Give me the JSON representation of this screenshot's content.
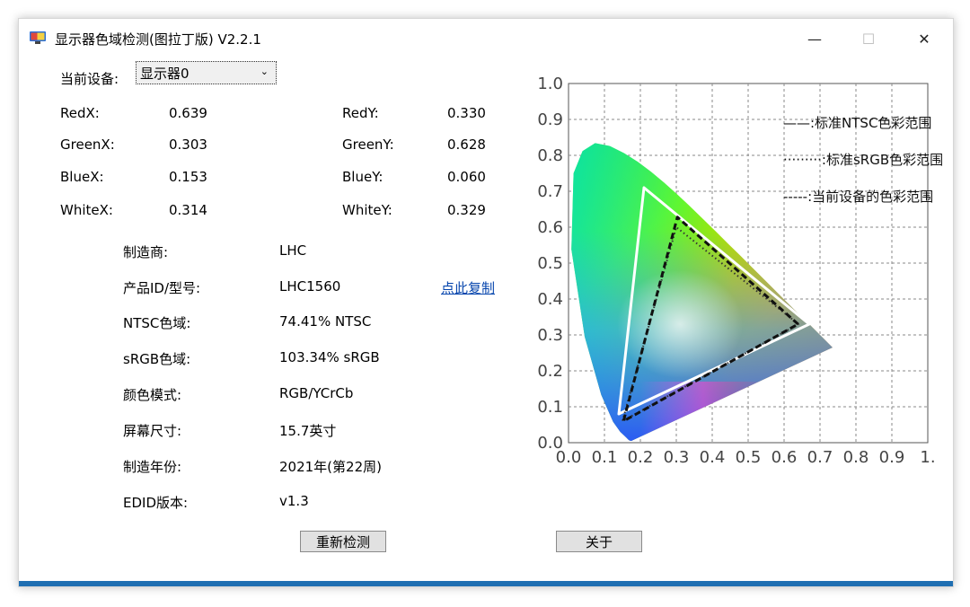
{
  "window": {
    "title": "显示器色域检测(图拉丁版) V2.2.1",
    "minimize_label": "—",
    "maximize_label": "☐",
    "close_label": "✕"
  },
  "device": {
    "label": "当前设备:",
    "selected": "显示器0"
  },
  "coords": [
    {
      "xlabel": "RedX:",
      "xval": "0.639",
      "ylabel": "RedY:",
      "yval": "0.330"
    },
    {
      "xlabel": "GreenX:",
      "xval": "0.303",
      "ylabel": "GreenY:",
      "yval": "0.628"
    },
    {
      "xlabel": "BlueX:",
      "xval": "0.153",
      "ylabel": "BlueY:",
      "yval": "0.060"
    },
    {
      "xlabel": "WhiteX:",
      "xval": "0.314",
      "ylabel": "WhiteY:",
      "yval": "0.329"
    }
  ],
  "info": [
    {
      "label": "制造商:",
      "value": "LHC"
    },
    {
      "label": "产品ID/型号:",
      "value": "LHC1560"
    },
    {
      "label": "NTSC色域:",
      "value": "74.41% NTSC"
    },
    {
      "label": "sRGB色域:",
      "value": "103.34% sRGB"
    },
    {
      "label": "颜色模式:",
      "value": "RGB/YCrCb"
    },
    {
      "label": "屏幕尺寸:",
      "value": "15.7英寸"
    },
    {
      "label": "制造年份:",
      "value": "2021年(第22周)"
    },
    {
      "label": "EDID版本:",
      "value": "v1.3"
    }
  ],
  "copy_link": "点此复制",
  "buttons": {
    "redetect": "重新检测",
    "about": "关于"
  },
  "chart_data": {
    "type": "scatter",
    "xlim": [
      0,
      1
    ],
    "ylim": [
      0,
      1
    ],
    "x_ticks": [
      "0.0",
      "0.1",
      "0.2",
      "0.3",
      "0.4",
      "0.5",
      "0.6",
      "0.7",
      "0.8",
      "0.9",
      "1."
    ],
    "y_ticks": [
      "0.0",
      "0.1",
      "0.2",
      "0.3",
      "0.4",
      "0.5",
      "0.6",
      "0.7",
      "0.8",
      "0.9",
      "1.0"
    ],
    "grid": true,
    "legend_placement": "top-right",
    "legend": [
      {
        "name": "——:标准NTSC色彩范围",
        "style": "solid"
      },
      {
        "name": "·········:标准sRGB色彩范围",
        "style": "dotted"
      },
      {
        "name": "-----:当前设备的色彩范围",
        "style": "dashed"
      }
    ],
    "ntsc": [
      [
        0.67,
        0.33
      ],
      [
        0.21,
        0.71
      ],
      [
        0.14,
        0.08
      ]
    ],
    "srgb": [
      [
        0.64,
        0.33
      ],
      [
        0.3,
        0.6
      ],
      [
        0.15,
        0.06
      ]
    ],
    "device": [
      [
        0.639,
        0.33
      ],
      [
        0.303,
        0.628
      ],
      [
        0.153,
        0.06
      ]
    ],
    "locus": [
      [
        0.175,
        0.005
      ],
      [
        0.173,
        0.005
      ],
      [
        0.168,
        0.007
      ],
      [
        0.16,
        0.015
      ],
      [
        0.144,
        0.03
      ],
      [
        0.124,
        0.058
      ],
      [
        0.091,
        0.133
      ],
      [
        0.045,
        0.295
      ],
      [
        0.008,
        0.538
      ],
      [
        0.014,
        0.75
      ],
      [
        0.039,
        0.812
      ],
      [
        0.074,
        0.834
      ],
      [
        0.115,
        0.826
      ],
      [
        0.155,
        0.806
      ],
      [
        0.193,
        0.782
      ],
      [
        0.23,
        0.754
      ],
      [
        0.266,
        0.724
      ],
      [
        0.302,
        0.692
      ],
      [
        0.337,
        0.659
      ],
      [
        0.373,
        0.624
      ],
      [
        0.409,
        0.589
      ],
      [
        0.444,
        0.554
      ],
      [
        0.479,
        0.52
      ],
      [
        0.512,
        0.487
      ],
      [
        0.545,
        0.454
      ],
      [
        0.575,
        0.424
      ],
      [
        0.603,
        0.396
      ],
      [
        0.627,
        0.372
      ],
      [
        0.648,
        0.351
      ],
      [
        0.666,
        0.334
      ],
      [
        0.68,
        0.32
      ],
      [
        0.691,
        0.309
      ],
      [
        0.701,
        0.299
      ],
      [
        0.735,
        0.265
      ]
    ],
    "colors": {
      "ntsc": "#ffffff",
      "srgb": "#333333",
      "device": "#111111"
    }
  }
}
